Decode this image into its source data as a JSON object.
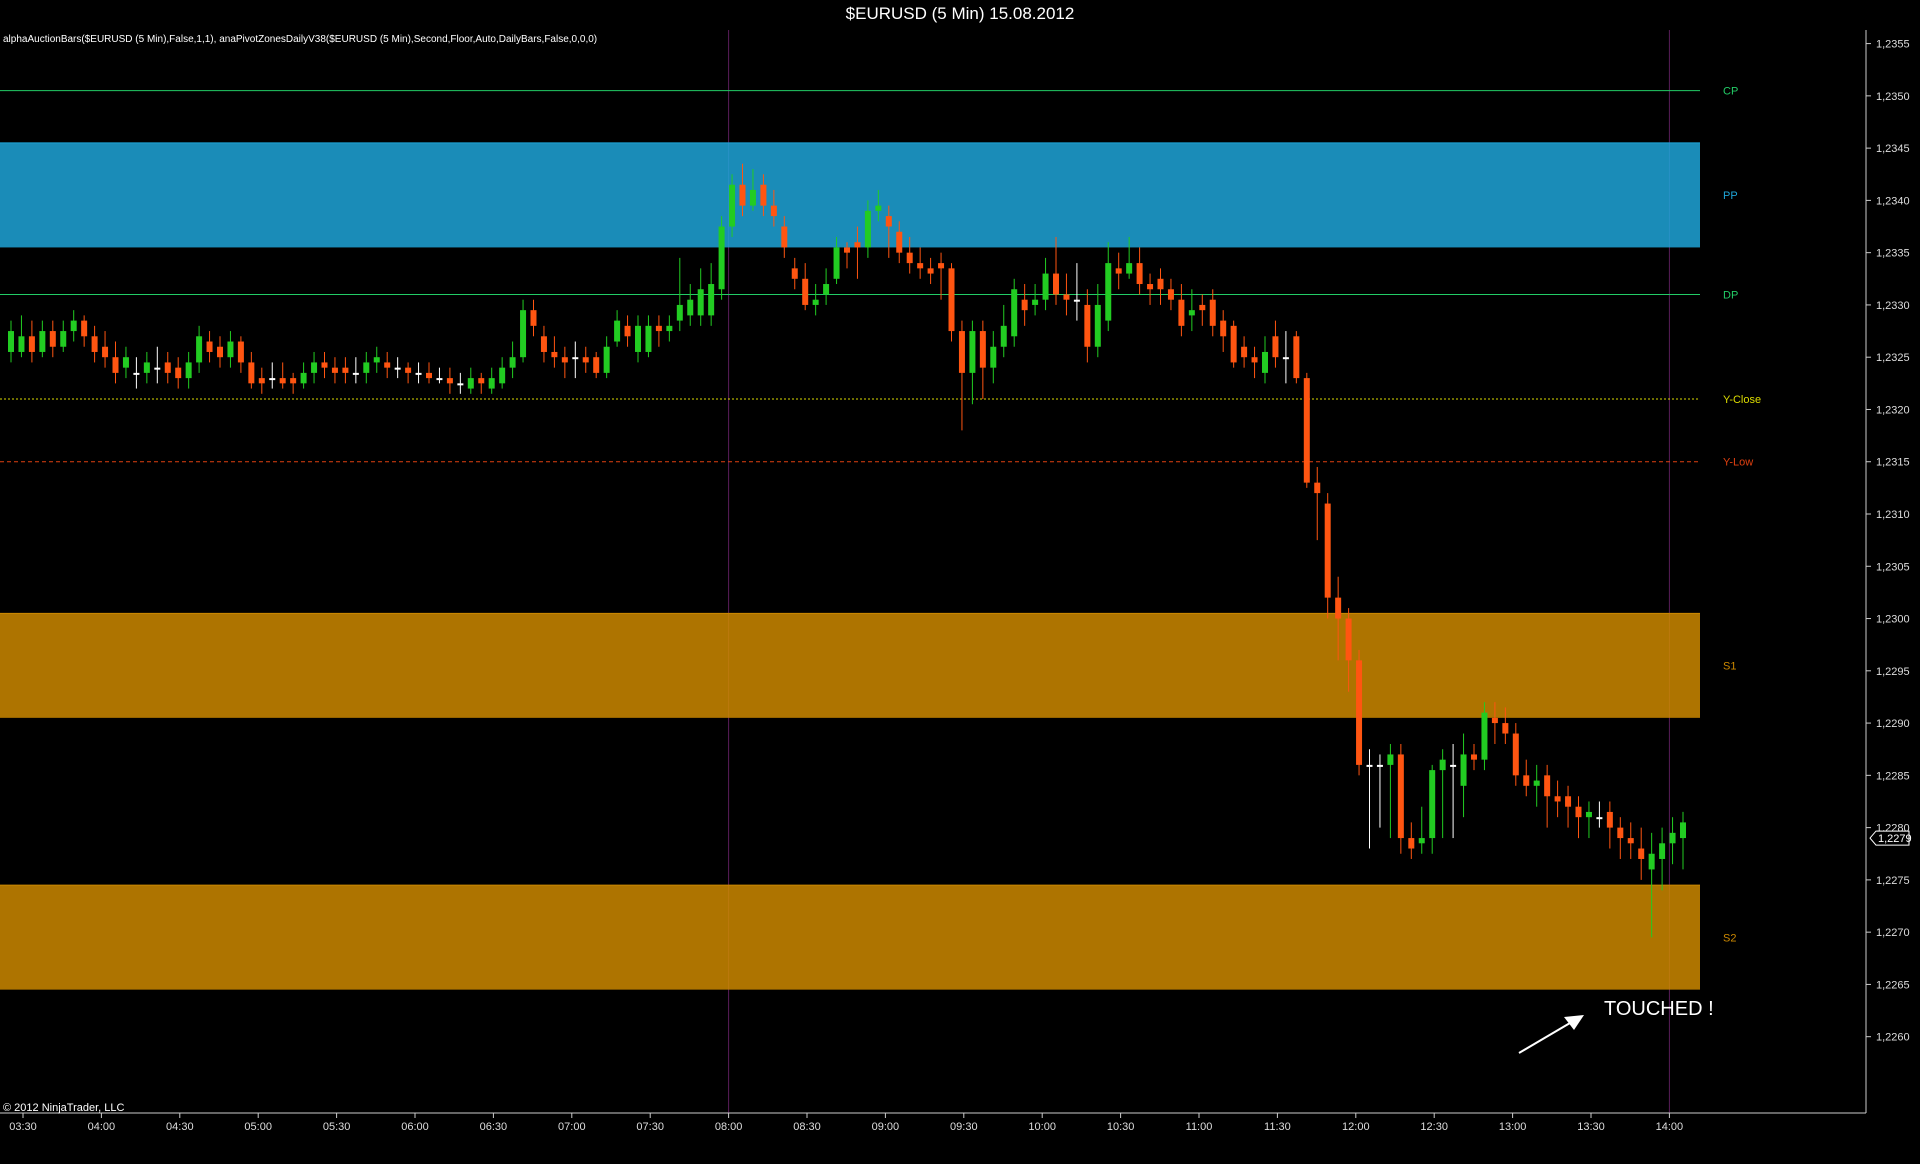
{
  "window": {
    "title": "$EURUSD (5 Min)  15.08.2012"
  },
  "indicator_text": "alphaAuctionBars($EURUSD (5 Min),False,1,1), anaPivotZonesDailyV38($EURUSD (5 Min),Second,Floor,Auto,DailyBars,False,0,0,0)",
  "copyright": "© 2012 NinjaTrader, LLC",
  "annotation": {
    "text": "TOUCHED !"
  },
  "current_price_label": "1,2279",
  "colors": {
    "background": "#000000",
    "up_candle": "#22cc22",
    "down_candle": "#ff5511",
    "neutral_candle": "#ffffff",
    "axis_text": "#dddddd",
    "CP": "#22cc66",
    "PP": "#1ea5d8",
    "DP": "#22cc66",
    "Y-Close": "#dddd00",
    "Y-Low": "#e04010",
    "S1": "#cc8800",
    "S2": "#cc8800"
  },
  "chart_data": {
    "type": "candlestick",
    "title": "$EURUSD (5 Min)  15.08.2012",
    "ylim": [
      1.2253,
      1.2357
    ],
    "y_ticks": [
      "1,2260",
      "1,2265",
      "1,2270",
      "1,2275",
      "1,2280",
      "1,2285",
      "1,2290",
      "1,2295",
      "1,2300",
      "1,2305",
      "1,2310",
      "1,2315",
      "1,2320",
      "1,2325",
      "1,2330",
      "1,2335",
      "1,2340",
      "1,2345",
      "1,2350",
      "1,2355"
    ],
    "x_ticks": [
      "03:30",
      "04:00",
      "04:30",
      "05:00",
      "05:30",
      "06:00",
      "06:30",
      "07:00",
      "07:30",
      "08:00",
      "08:30",
      "09:00",
      "09:30",
      "10:00",
      "10:30",
      "11:00",
      "11:30",
      "12:00",
      "12:30",
      "13:00",
      "13:30",
      "14:00"
    ],
    "session_dividers": [
      "08:00",
      "14:00"
    ],
    "levels": [
      {
        "name": "CP",
        "price": 1.23505,
        "style": "line"
      },
      {
        "name": "PP",
        "price": 1.23405,
        "style": "band",
        "half": 0.0005
      },
      {
        "name": "DP",
        "price": 1.2331,
        "style": "line"
      },
      {
        "name": "Y-Close",
        "price": 1.2321,
        "style": "dotted"
      },
      {
        "name": "Y-Low",
        "price": 1.2315,
        "style": "dashed"
      },
      {
        "name": "S1",
        "price": 1.22955,
        "style": "band",
        "half": 0.0005
      },
      {
        "name": "S2",
        "price": 1.22695,
        "style": "band",
        "half": 0.0005
      }
    ],
    "last_price": 1.2279,
    "candles": [
      [
        1.23255,
        1.23275,
        1.23285,
        1.23245
      ],
      [
        1.23255,
        1.2327,
        1.2329,
        1.2325
      ],
      [
        1.2327,
        1.23255,
        1.23285,
        1.23245
      ],
      [
        1.23255,
        1.23275,
        1.23285,
        1.2325
      ],
      [
        1.23275,
        1.2326,
        1.23285,
        1.2325
      ],
      [
        1.2326,
        1.23275,
        1.23285,
        1.23255
      ],
      [
        1.23275,
        1.23285,
        1.23295,
        1.23265
      ],
      [
        1.23285,
        1.2327,
        1.2329,
        1.2326
      ],
      [
        1.2327,
        1.23255,
        1.2328,
        1.23245
      ],
      [
        1.2326,
        1.2325,
        1.23275,
        1.2324
      ],
      [
        1.2325,
        1.23235,
        1.23265,
        1.23225
      ],
      [
        1.2324,
        1.2325,
        1.2326,
        1.2323
      ],
      [
        1.23235,
        1.23235,
        1.2325,
        1.2322
      ],
      [
        1.23235,
        1.23245,
        1.23255,
        1.23225
      ],
      [
        1.2324,
        1.2324,
        1.2326,
        1.23225
      ],
      [
        1.23245,
        1.23235,
        1.23255,
        1.23225
      ],
      [
        1.2324,
        1.2323,
        1.2325,
        1.2322
      ],
      [
        1.2323,
        1.23245,
        1.23255,
        1.2322
      ],
      [
        1.23245,
        1.2327,
        1.2328,
        1.23235
      ],
      [
        1.23265,
        1.23255,
        1.23275,
        1.23245
      ],
      [
        1.2326,
        1.2325,
        1.2327,
        1.2324
      ],
      [
        1.2325,
        1.23265,
        1.23275,
        1.2324
      ],
      [
        1.23265,
        1.23245,
        1.2327,
        1.23235
      ],
      [
        1.23245,
        1.23225,
        1.23255,
        1.2322
      ],
      [
        1.2323,
        1.23225,
        1.2324,
        1.23215
      ],
      [
        1.2323,
        1.2323,
        1.23245,
        1.2322
      ],
      [
        1.2323,
        1.23225,
        1.23245,
        1.2322
      ],
      [
        1.2323,
        1.23225,
        1.23235,
        1.23215
      ],
      [
        1.23225,
        1.23235,
        1.23245,
        1.2322
      ],
      [
        1.23235,
        1.23245,
        1.23255,
        1.23225
      ],
      [
        1.23245,
        1.2324,
        1.23255,
        1.2323
      ],
      [
        1.2324,
        1.23235,
        1.2325,
        1.23225
      ],
      [
        1.2324,
        1.23235,
        1.2325,
        1.23225
      ],
      [
        1.23235,
        1.23235,
        1.2325,
        1.23225
      ],
      [
        1.23235,
        1.23245,
        1.23255,
        1.23225
      ],
      [
        1.23245,
        1.2325,
        1.2326,
        1.23235
      ],
      [
        1.23245,
        1.2324,
        1.23255,
        1.2323
      ],
      [
        1.2324,
        1.2324,
        1.2325,
        1.2323
      ],
      [
        1.2324,
        1.23235,
        1.23245,
        1.23225
      ],
      [
        1.23235,
        1.23235,
        1.23245,
        1.23225
      ],
      [
        1.23235,
        1.2323,
        1.23245,
        1.23225
      ],
      [
        1.2323,
        1.2323,
        1.2324,
        1.23225
      ],
      [
        1.2323,
        1.23225,
        1.2324,
        1.23215
      ],
      [
        1.23225,
        1.23225,
        1.23235,
        1.23215
      ],
      [
        1.2322,
        1.2323,
        1.2324,
        1.23215
      ],
      [
        1.2323,
        1.23225,
        1.23235,
        1.23215
      ],
      [
        1.2322,
        1.2323,
        1.2324,
        1.23215
      ],
      [
        1.23225,
        1.2324,
        1.2325,
        1.2322
      ],
      [
        1.2324,
        1.2325,
        1.23265,
        1.2323
      ],
      [
        1.2325,
        1.23295,
        1.23305,
        1.23245
      ],
      [
        1.23295,
        1.2328,
        1.23305,
        1.2327
      ],
      [
        1.2327,
        1.23255,
        1.2328,
        1.23245
      ],
      [
        1.23255,
        1.2325,
        1.2327,
        1.2324
      ],
      [
        1.2325,
        1.23245,
        1.2326,
        1.2323
      ],
      [
        1.2325,
        1.2325,
        1.23265,
        1.2323
      ],
      [
        1.2325,
        1.23245,
        1.2326,
        1.23235
      ],
      [
        1.2325,
        1.23235,
        1.23255,
        1.2323
      ],
      [
        1.23235,
        1.2326,
        1.2327,
        1.2323
      ],
      [
        1.23265,
        1.23285,
        1.23295,
        1.2326
      ],
      [
        1.2328,
        1.2327,
        1.2329,
        1.2326
      ],
      [
        1.23255,
        1.2328,
        1.2329,
        1.23245
      ],
      [
        1.23255,
        1.2328,
        1.2329,
        1.2325
      ],
      [
        1.2328,
        1.23275,
        1.2329,
        1.2326
      ],
      [
        1.23275,
        1.2328,
        1.2329,
        1.23265
      ],
      [
        1.23285,
        1.233,
        1.23345,
        1.23275
      ],
      [
        1.2329,
        1.23305,
        1.2332,
        1.2328
      ],
      [
        1.2329,
        1.23315,
        1.23335,
        1.2328
      ],
      [
        1.2329,
        1.2332,
        1.2334,
        1.2328
      ],
      [
        1.23315,
        1.23375,
        1.23385,
        1.23305
      ],
      [
        1.23375,
        1.23415,
        1.23425,
        1.23365
      ],
      [
        1.23415,
        1.23395,
        1.23435,
        1.23385
      ],
      [
        1.23395,
        1.2341,
        1.2343,
        1.2339
      ],
      [
        1.23415,
        1.23395,
        1.23425,
        1.23385
      ],
      [
        1.23395,
        1.23385,
        1.2341,
        1.23375
      ],
      [
        1.23375,
        1.23355,
        1.23385,
        1.23345
      ],
      [
        1.23335,
        1.23325,
        1.23345,
        1.23315
      ],
      [
        1.23325,
        1.233,
        1.2334,
        1.23295
      ],
      [
        1.233,
        1.23305,
        1.2332,
        1.2329
      ],
      [
        1.2331,
        1.2332,
        1.23335,
        1.233
      ],
      [
        1.23325,
        1.23355,
        1.23365,
        1.2332
      ],
      [
        1.23355,
        1.2335,
        1.2336,
        1.23335
      ],
      [
        1.2336,
        1.23355,
        1.23375,
        1.23325
      ],
      [
        1.23355,
        1.2339,
        1.234,
        1.23345
      ],
      [
        1.2339,
        1.23395,
        1.2341,
        1.2338
      ],
      [
        1.23385,
        1.23375,
        1.23395,
        1.23345
      ],
      [
        1.2337,
        1.2335,
        1.2338,
        1.2334
      ],
      [
        1.2335,
        1.2334,
        1.23365,
        1.2333
      ],
      [
        1.2334,
        1.23335,
        1.23355,
        1.23325
      ],
      [
        1.23335,
        1.2333,
        1.23345,
        1.2332
      ],
      [
        1.2334,
        1.23335,
        1.2335,
        1.23305
      ],
      [
        1.23335,
        1.23275,
        1.2334,
        1.23265
      ],
      [
        1.23275,
        1.23235,
        1.23285,
        1.2318
      ],
      [
        1.23235,
        1.23275,
        1.23285,
        1.23205
      ],
      [
        1.23275,
        1.2324,
        1.23285,
        1.2321
      ],
      [
        1.2324,
        1.2326,
        1.23275,
        1.23225
      ],
      [
        1.2326,
        1.2328,
        1.233,
        1.2325
      ],
      [
        1.2327,
        1.23315,
        1.23325,
        1.2326
      ],
      [
        1.23305,
        1.23295,
        1.2332,
        1.2328
      ],
      [
        1.233,
        1.23305,
        1.2332,
        1.2329
      ],
      [
        1.23305,
        1.2333,
        1.23345,
        1.23295
      ],
      [
        1.2333,
        1.2331,
        1.23365,
        1.233
      ],
      [
        1.2331,
        1.23305,
        1.2333,
        1.2329
      ],
      [
        1.23305,
        1.23305,
        1.2334,
        1.23285
      ],
      [
        1.233,
        1.2326,
        1.23315,
        1.23245
      ],
      [
        1.2326,
        1.233,
        1.2332,
        1.2325
      ],
      [
        1.23285,
        1.2334,
        1.2336,
        1.23275
      ],
      [
        1.23335,
        1.2333,
        1.2335,
        1.23315
      ],
      [
        1.2333,
        1.2334,
        1.23365,
        1.23325
      ],
      [
        1.2334,
        1.2332,
        1.23355,
        1.2331
      ],
      [
        1.2332,
        1.23315,
        1.2333,
        1.233
      ],
      [
        1.23325,
        1.23315,
        1.23335,
        1.233
      ],
      [
        1.23315,
        1.23305,
        1.23325,
        1.23295
      ],
      [
        1.23305,
        1.2328,
        1.2332,
        1.2327
      ],
      [
        1.2329,
        1.23295,
        1.23315,
        1.23275
      ],
      [
        1.233,
        1.23295,
        1.2331,
        1.2328
      ],
      [
        1.23305,
        1.2328,
        1.23315,
        1.2327
      ],
      [
        1.23285,
        1.2327,
        1.23295,
        1.23255
      ],
      [
        1.2328,
        1.23245,
        1.23285,
        1.2324
      ],
      [
        1.2326,
        1.2325,
        1.2327,
        1.2324
      ],
      [
        1.2325,
        1.23245,
        1.2326,
        1.2323
      ],
      [
        1.23235,
        1.23255,
        1.2327,
        1.23225
      ],
      [
        1.2327,
        1.2325,
        1.23285,
        1.2324
      ],
      [
        1.2325,
        1.2325,
        1.23275,
        1.23225
      ],
      [
        1.2327,
        1.2323,
        1.23275,
        1.23225
      ],
      [
        1.2323,
        1.2313,
        1.23235,
        1.23125
      ],
      [
        1.2313,
        1.2312,
        1.23145,
        1.23075
      ],
      [
        1.2311,
        1.2302,
        1.2312,
        1.23
      ],
      [
        1.2302,
        1.23,
        1.2304,
        1.2296
      ],
      [
        1.23,
        1.2296,
        1.2301,
        1.2293
      ],
      [
        1.2296,
        1.2286,
        1.2297,
        1.2285
      ],
      [
        1.2286,
        1.2286,
        1.22875,
        1.2278
      ],
      [
        1.2286,
        1.2286,
        1.2287,
        1.228
      ],
      [
        1.2286,
        1.2287,
        1.2288,
        1.2279
      ],
      [
        1.2287,
        1.2279,
        1.2288,
        1.22775
      ],
      [
        1.2279,
        1.2278,
        1.22805,
        1.2277
      ],
      [
        1.22785,
        1.2279,
        1.2282,
        1.22775
      ],
      [
        1.2279,
        1.22855,
        1.2286,
        1.22775
      ],
      [
        1.22855,
        1.22865,
        1.22875,
        1.2279
      ],
      [
        1.2286,
        1.2286,
        1.2288,
        1.2279
      ],
      [
        1.2284,
        1.2287,
        1.2289,
        1.2281
      ],
      [
        1.2287,
        1.22865,
        1.2288,
        1.22855
      ],
      [
        1.22865,
        1.2291,
        1.2292,
        1.22855
      ],
      [
        1.22905,
        1.229,
        1.2292,
        1.2288
      ],
      [
        1.229,
        1.2289,
        1.22915,
        1.2288
      ],
      [
        1.2289,
        1.2285,
        1.229,
        1.2284
      ],
      [
        1.2285,
        1.2284,
        1.22865,
        1.2283
      ],
      [
        1.2284,
        1.22845,
        1.2286,
        1.2282
      ],
      [
        1.2285,
        1.2283,
        1.2286,
        1.228
      ],
      [
        1.2283,
        1.22825,
        1.22845,
        1.2281
      ],
      [
        1.2283,
        1.2282,
        1.2284,
        1.228
      ],
      [
        1.2282,
        1.2281,
        1.2283,
        1.2279
      ],
      [
        1.2281,
        1.22815,
        1.22825,
        1.2279
      ],
      [
        1.2281,
        1.2281,
        1.22825,
        1.228
      ],
      [
        1.22815,
        1.228,
        1.22825,
        1.2278
      ],
      [
        1.228,
        1.2279,
        1.2281,
        1.2277
      ],
      [
        1.2279,
        1.22785,
        1.22805,
        1.2277
      ],
      [
        1.2278,
        1.2277,
        1.228,
        1.2275
      ],
      [
        1.2276,
        1.22775,
        1.22795,
        1.22695
      ],
      [
        1.2277,
        1.22785,
        1.228,
        1.2274
      ],
      [
        1.22785,
        1.22795,
        1.2281,
        1.22765
      ],
      [
        1.2279,
        1.22805,
        1.22815,
        1.2276
      ]
    ]
  }
}
